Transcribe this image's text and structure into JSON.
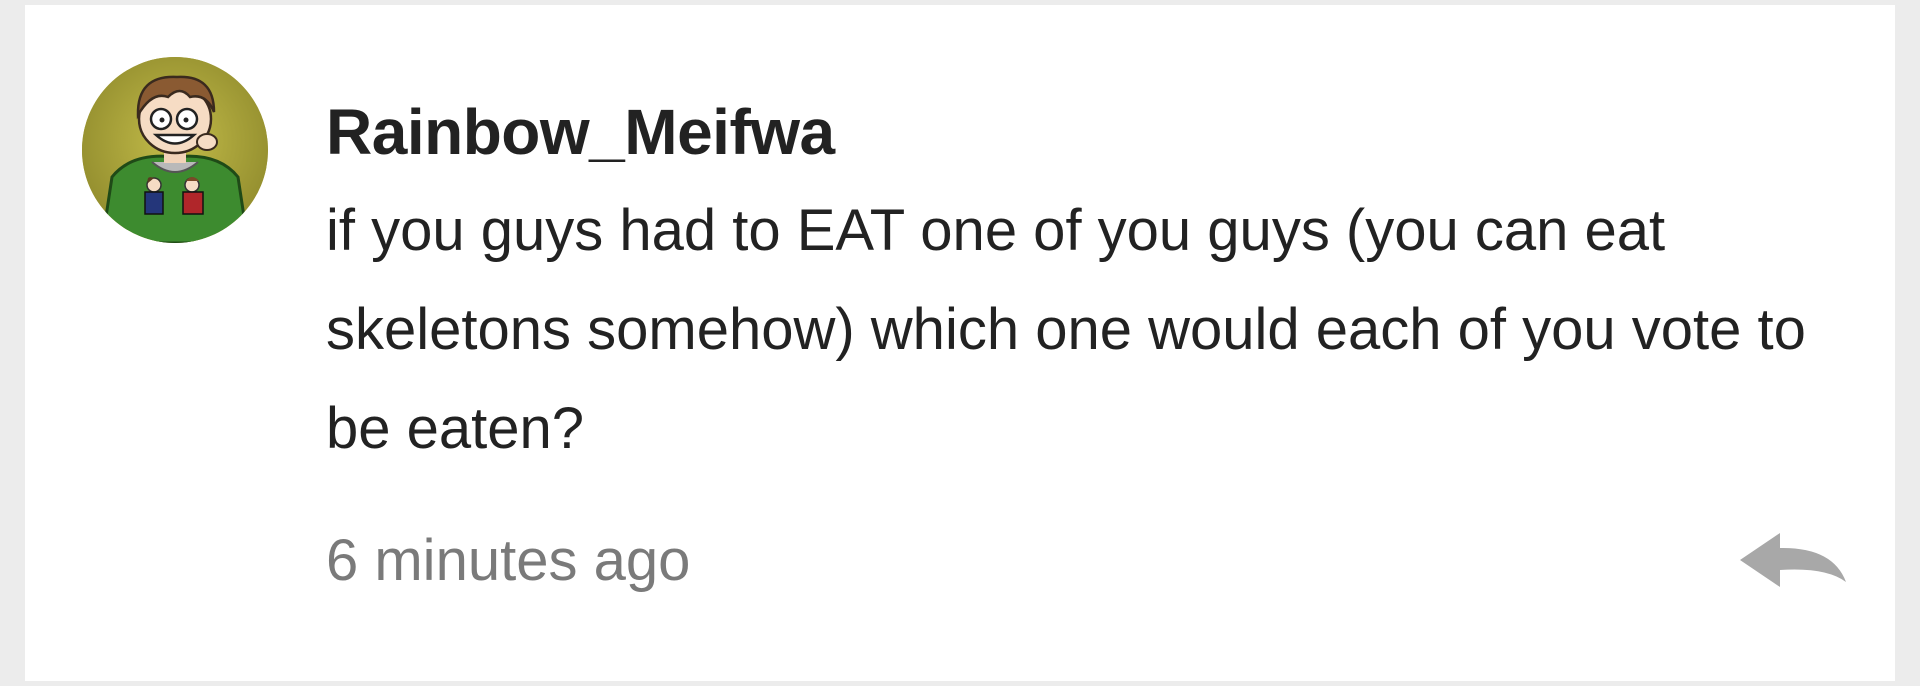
{
  "comment": {
    "username": "Rainbow_Meifwa",
    "message": "if you guys had to EAT one of you guys (you can eat skeletons somehow) which one would each of you vote to be eaten?",
    "timestamp": "6 minutes ago",
    "avatar_icon": "avatar-cartoon-character",
    "reply_icon": "reply-arrow-icon"
  },
  "colors": {
    "page_background": "#ececec",
    "card_background": "#ffffff",
    "text_primary": "#222222",
    "text_secondary": "#7a7a7a",
    "reply_icon": "#a8a8a8",
    "avatar_background": "#a9a438"
  }
}
